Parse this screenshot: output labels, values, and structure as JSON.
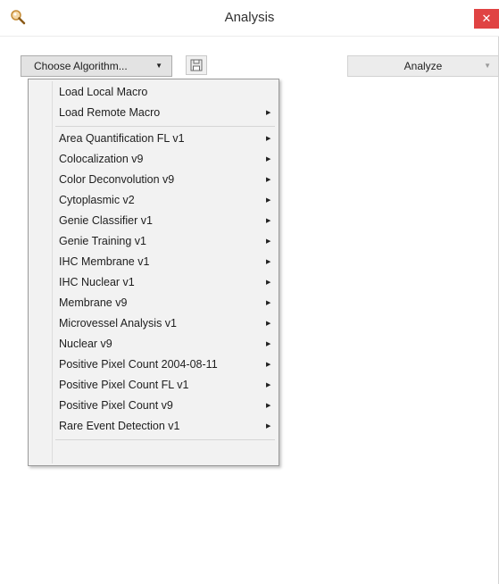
{
  "window": {
    "title": "Analysis",
    "close_label": "✕"
  },
  "toolbar": {
    "choose_label": "Choose Algorithm...",
    "dropdown_arrow": "▼",
    "save_icon": "save-icon",
    "analyze_label": "Analyze"
  },
  "menu": {
    "submenu_arrow": "▶",
    "top_items": [
      {
        "label": "Load Local Macro",
        "has_submenu": false
      },
      {
        "label": "Load Remote Macro",
        "has_submenu": true
      }
    ],
    "algorithm_items": [
      {
        "label": "Area Quantification FL v1",
        "has_submenu": true
      },
      {
        "label": "Colocalization v9",
        "has_submenu": true
      },
      {
        "label": "Color Deconvolution v9",
        "has_submenu": true
      },
      {
        "label": "Cytoplasmic v2",
        "has_submenu": true
      },
      {
        "label": "Genie Classifier v1",
        "has_submenu": true
      },
      {
        "label": "Genie Training v1",
        "has_submenu": true
      },
      {
        "label": "IHC Membrane v1",
        "has_submenu": true
      },
      {
        "label": "IHC Nuclear v1",
        "has_submenu": true
      },
      {
        "label": "Membrane v9",
        "has_submenu": true
      },
      {
        "label": "Microvessel Analysis v1",
        "has_submenu": true
      },
      {
        "label": "Nuclear v9",
        "has_submenu": true
      },
      {
        "label": "Positive Pixel Count 2004-08-11",
        "has_submenu": true
      },
      {
        "label": "Positive Pixel Count FL v1",
        "has_submenu": true
      },
      {
        "label": "Positive Pixel Count v9",
        "has_submenu": true
      },
      {
        "label": "Rare Event Detection v1",
        "has_submenu": true
      }
    ]
  }
}
